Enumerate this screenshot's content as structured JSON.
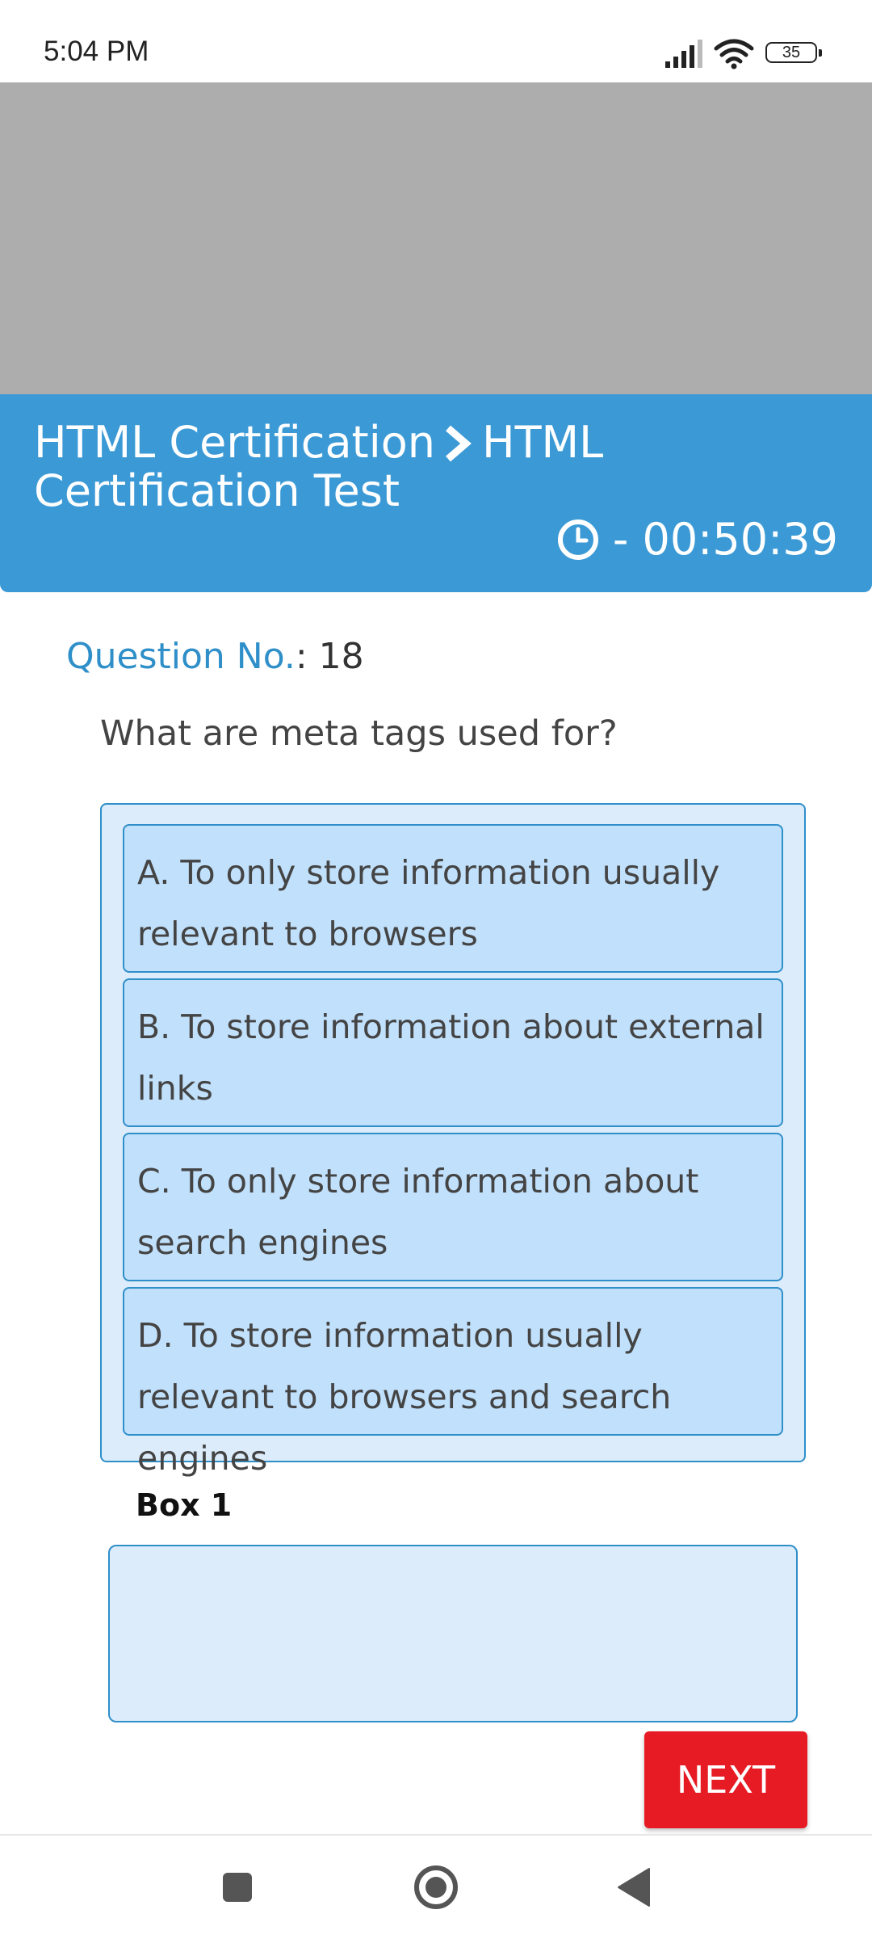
{
  "status_bar": {
    "time": "5:04 PM",
    "battery": "35",
    "icons": [
      "signal-icon",
      "wifi-icon",
      "battery-icon"
    ]
  },
  "header": {
    "breadcrumb_parent": "HTML Certification",
    "breadcrumb_current": "HTML Certification Test",
    "timer": "- 00:50:39",
    "icons": [
      "chevron-right-icon",
      "clock-icon"
    ]
  },
  "question": {
    "number_label": "Question No.",
    "number_sep": ": ",
    "number": "18",
    "text": "What are meta tags used for?"
  },
  "options": [
    {
      "label": "A. To only store information usually relevant to browsers"
    },
    {
      "label": "B. To store information about external links"
    },
    {
      "label": "C. To only store information about search engines"
    },
    {
      "label": "D. To store information usually relevant to browsers and search engines"
    }
  ],
  "answer": {
    "box_label": "Box 1",
    "value": ""
  },
  "actions": {
    "next_label": "NEXT"
  },
  "navigation": {
    "icons": [
      "recent-apps-icon",
      "home-icon",
      "back-icon"
    ]
  },
  "colors": {
    "header_bg": "#3b9ad6",
    "accent": "#2f8fc9",
    "option_bg": "#c1e0fb",
    "panel_bg": "#dcecfb",
    "next_button": "#e61b23",
    "ad_area": "#adadad"
  }
}
